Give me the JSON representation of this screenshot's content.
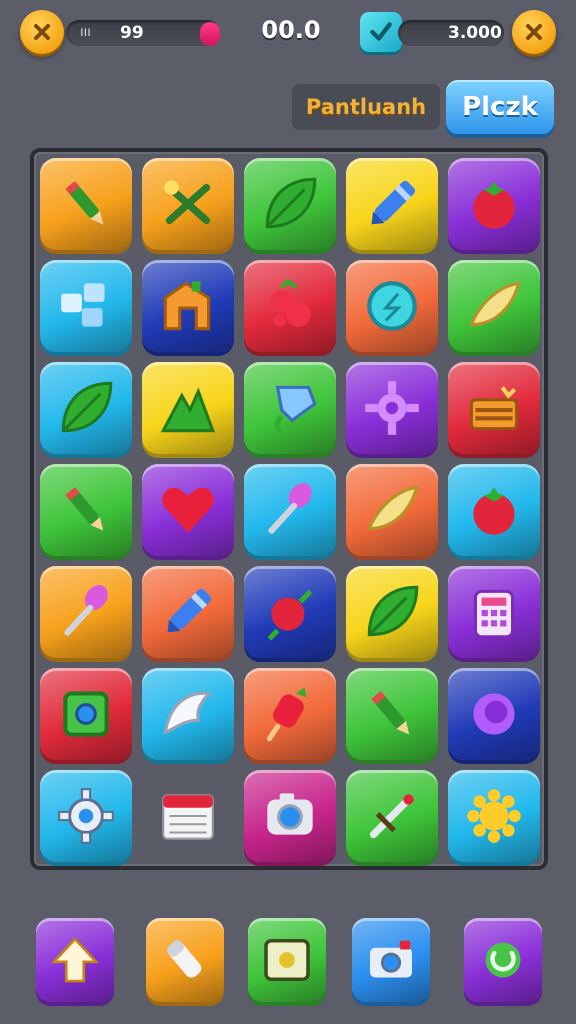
{
  "hud": {
    "left_label": "ııı",
    "left_value": "99",
    "score": "00.0",
    "right_value": "3.000"
  },
  "header": {
    "title": "Pantluanh",
    "play_button": "Plczk"
  },
  "colors": {
    "orange": "#f7a11c",
    "green": "#3fc53a",
    "yellow": "#f8d51a",
    "purple": "#8a2fd8",
    "cyan": "#22b8ec",
    "navy": "#213bb8",
    "red": "#e22a3b",
    "coral": "#f26a3a",
    "magenta": "#c8258c",
    "blue": "#2b8ff0"
  },
  "grid": [
    [
      "orange:pencil-icon",
      "orange:scissors-icon",
      "green:leaf-icon",
      "yellow:crayon-icon",
      "purple:tomato-icon"
    ],
    [
      "cyan:blocks-icon",
      "navy:house-letter-icon",
      "red:berries-icon",
      "coral:clock-icon",
      "green:banana-icon"
    ],
    [
      "cyan:leaf-icon",
      "yellow:mountain-icon",
      "green:diamond-icon",
      "purple:gear-icon",
      "red:treasure-box-icon"
    ],
    [
      "green:pencil-icon",
      "purple:heart-icon",
      "cyan:spoon-icon",
      "coral:banana-icon",
      "cyan:tomato-icon"
    ],
    [
      "orange:spoon-icon",
      "coral:crayon-icon",
      "navy:rose-icon",
      "yellow:leaf-icon",
      "purple:calculator-icon"
    ],
    [
      "red:square-frame-icon",
      "cyan:tooth-icon",
      "coral:ice-pop-icon",
      "green:pencil-icon",
      "navy:swirl-icon"
    ],
    [
      "cyan:cog-icon",
      "none:calendar-icon",
      "magenta:camera-lens-icon",
      "green:dagger-icon",
      "cyan:sun-icon"
    ]
  ],
  "dock": [
    "purple:up-arrow-icon",
    "orange:eraser-icon",
    "green:screen-icon",
    "blue:camera-icon",
    "purple:refresh-icon"
  ]
}
